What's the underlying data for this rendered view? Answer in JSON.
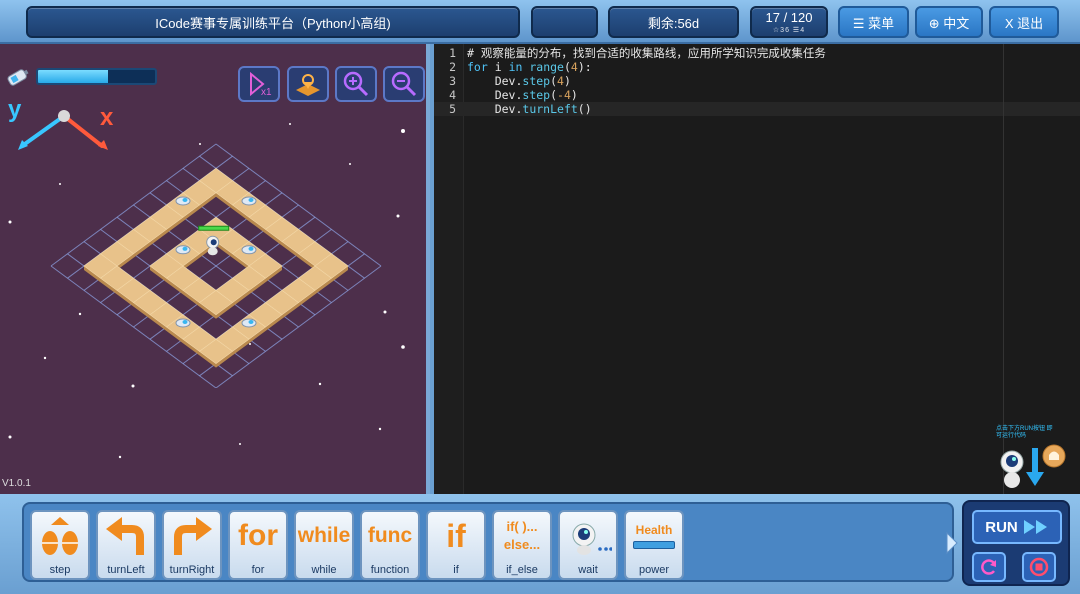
{
  "topbar": {
    "title": "ICode赛事专属训练平台（Python小高组)",
    "remaining": "剩余:56d",
    "progress": "17 / 120",
    "progress_sub": "☆36 ☰4",
    "menu_label": "☰ 菜单",
    "lang_label": "⊕ 中文",
    "exit_label": "X 退出"
  },
  "game": {
    "energy_level": 0.6,
    "axis_y": "y",
    "axis_x": "x",
    "version": "V1.0.1",
    "tools": [
      "reset-view-icon",
      "map-icon",
      "zoom-in-icon",
      "zoom-out-icon"
    ]
  },
  "code": {
    "lines": [
      {
        "n": "1",
        "text": "# 观察能量的分布，找到合适的收集路线，应用所学知识完成收集任务"
      },
      {
        "n": "2",
        "kw": "for",
        "mid": " i ",
        "kw2": "in",
        "fn": " range",
        "rest": "(",
        "num": "4",
        "end": "):"
      },
      {
        "n": "3",
        "indent": "    ",
        "obj": "Dev.",
        "fn": "step",
        "open": "(",
        "num": "4",
        "close": ")"
      },
      {
        "n": "4",
        "indent": "    ",
        "obj": "Dev.",
        "fn": "step",
        "open": "(",
        "num": "-4",
        "close": ")"
      },
      {
        "n": "5",
        "indent": "    ",
        "obj": "Dev.",
        "fn": "turnLeft",
        "open": "()",
        "num": "",
        "close": ""
      }
    ],
    "mascot_hint": "点击下方RUN按钮 即可运行代码"
  },
  "blocks": [
    {
      "label": "step",
      "icon": "step-icon"
    },
    {
      "label": "turnLeft",
      "icon": "turn-left-icon"
    },
    {
      "label": "turnRight",
      "icon": "turn-right-icon"
    },
    {
      "label": "for",
      "icon": "for-icon",
      "glyph": "for"
    },
    {
      "label": "while",
      "icon": "while-icon",
      "glyph": "while"
    },
    {
      "label": "function",
      "icon": "func-icon",
      "glyph": "func"
    },
    {
      "label": "if",
      "icon": "if-icon",
      "glyph": "if"
    },
    {
      "label": "if_else",
      "icon": "if-else-icon",
      "glyph": "if( )...",
      "glyph2": "else..."
    },
    {
      "label": "wait",
      "icon": "wait-icon"
    },
    {
      "label": "power",
      "icon": "health-icon",
      "glyph": "Health"
    }
  ],
  "run": {
    "label": "RUN"
  },
  "colors": {
    "accent": "#2c62b6",
    "tile": "#e8c28a",
    "space": "#4d2f4b",
    "code_bg": "#1b1b1b",
    "comment": "#3ec8e0"
  }
}
